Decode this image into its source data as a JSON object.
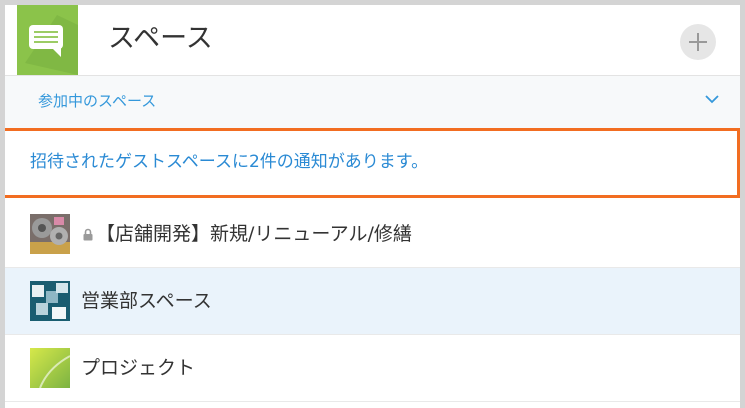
{
  "header": {
    "title": "スペース",
    "app_icon": "speech-bubble-icon",
    "add_icon": "plus-icon"
  },
  "filter": {
    "label": "参加中のスペース",
    "chevron_icon": "chevron-down-icon"
  },
  "notification": {
    "text": "招待されたゲストスペースに2件の通知があります。",
    "border_color": "#f26d21"
  },
  "spaces": [
    {
      "name": "【店舗開発】新規/リニューアル/修繕",
      "locked": true,
      "lock_icon": "lock-icon",
      "thumbnail": "gears-thumbnail"
    },
    {
      "name": "営業部スペース",
      "locked": false,
      "thumbnail": "cubes-thumbnail",
      "selected": true
    },
    {
      "name": "プロジェクト",
      "locked": false,
      "thumbnail": "green-gradient-thumbnail"
    }
  ],
  "colors": {
    "accent": "#3498db",
    "brand_green": "#8bc34a",
    "selected_row": "#eaf3fb",
    "highlight_border": "#f26d21"
  }
}
